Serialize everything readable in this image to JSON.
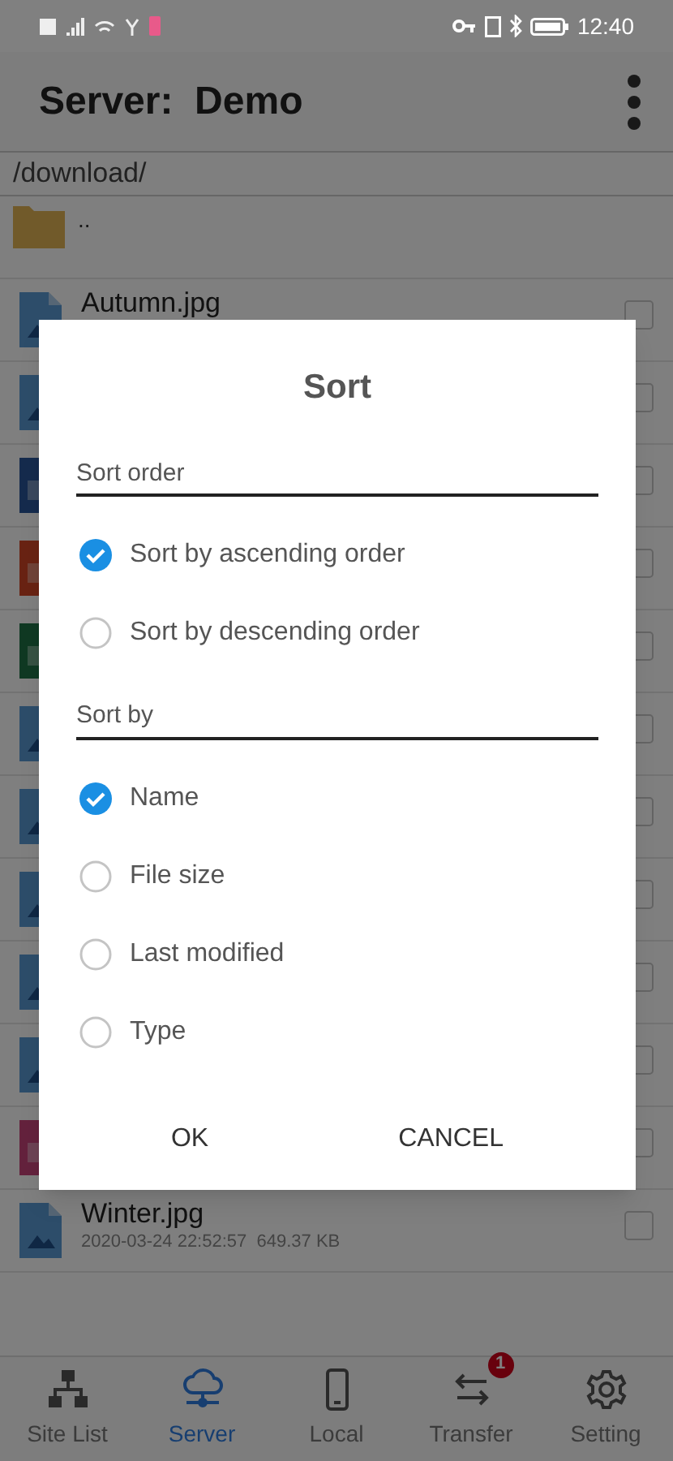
{
  "status_bar": {
    "time": "12:40"
  },
  "header": {
    "title": "Server:  Demo"
  },
  "path": "/download/",
  "parent_folder": {
    "name": ".."
  },
  "files": [
    {
      "kind": "image",
      "name": "Autumn.jpg",
      "checked": false
    },
    {
      "kind": "image",
      "checked": false
    },
    {
      "kind": "word",
      "checked": false
    },
    {
      "kind": "pdf",
      "checked": false
    },
    {
      "kind": "excel",
      "checked": false
    },
    {
      "kind": "image",
      "checked": false
    },
    {
      "kind": "image",
      "checked": false
    },
    {
      "kind": "image",
      "checked": false
    },
    {
      "kind": "image",
      "checked": false
    },
    {
      "kind": "image",
      "checked": false
    },
    {
      "kind": "ppt",
      "checked": false
    },
    {
      "kind": "image",
      "name": "Winter.jpg",
      "meta": "2020-03-24 22:52:57  649.37 KB",
      "checked": false
    }
  ],
  "dialog": {
    "title": "Sort",
    "sections": [
      {
        "label": "Sort order",
        "options": [
          {
            "label": "Sort by ascending order",
            "selected": true
          },
          {
            "label": "Sort by descending order",
            "selected": false
          }
        ]
      },
      {
        "label": "Sort by",
        "options": [
          {
            "label": "Name",
            "selected": true
          },
          {
            "label": "File size",
            "selected": false
          },
          {
            "label": "Last modified",
            "selected": false
          },
          {
            "label": "Type",
            "selected": false
          }
        ]
      }
    ],
    "buttons": [
      "OK",
      "CANCEL"
    ]
  },
  "bottom_nav": [
    {
      "kind": "sites",
      "label": "Site List",
      "selected": false
    },
    {
      "kind": "server",
      "label": "Server",
      "selected": true
    },
    {
      "kind": "local",
      "label": "Local",
      "selected": false
    },
    {
      "kind": "transfer",
      "label": "Transfer",
      "selected": false,
      "badge": "1"
    },
    {
      "kind": "settings",
      "label": "Setting",
      "selected": false
    }
  ]
}
